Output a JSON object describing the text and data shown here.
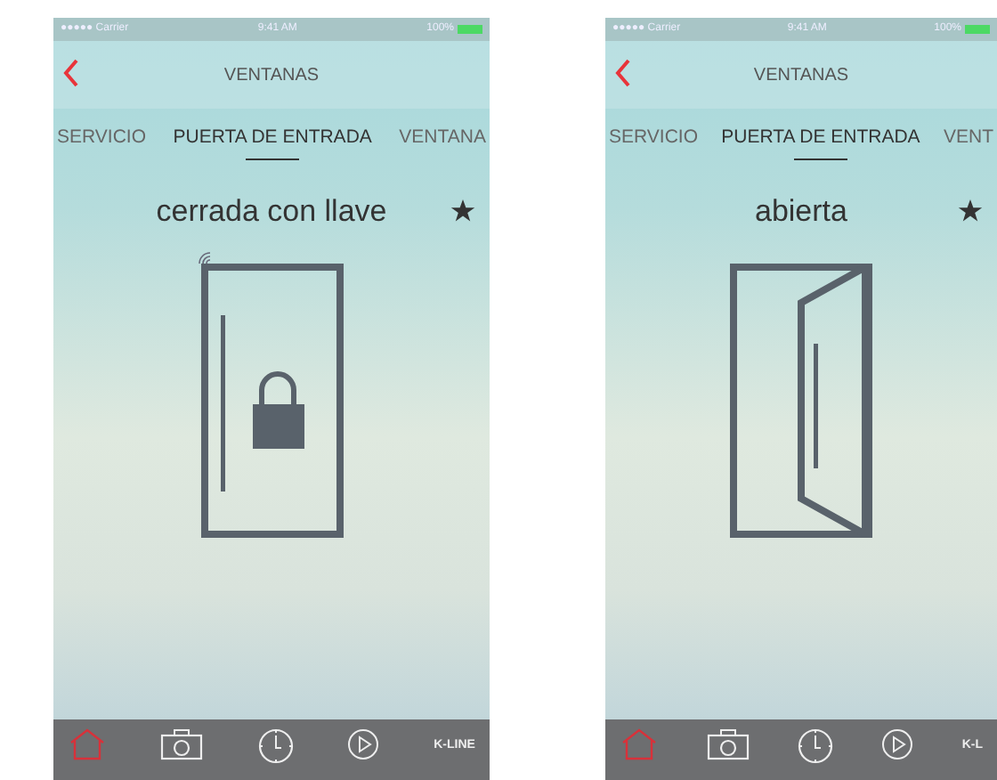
{
  "screens": [
    {
      "status_bar": {
        "carrier": "●●●●● Carrier",
        "time": "9:41 AM",
        "battery": "100%"
      },
      "title": "VENTANAS",
      "tabs": [
        {
          "label": "SERVICIO",
          "selected": false
        },
        {
          "label": "PUERTA DE ENTRADA",
          "selected": true
        },
        {
          "label": "VENTANA",
          "selected": false
        }
      ],
      "state_label": "cerrada con llave",
      "door": {
        "kind": "locked",
        "signal": true
      },
      "favorite": true,
      "tab_bar": [
        {
          "kind": "home",
          "selected": true
        },
        {
          "kind": "camera",
          "selected": false
        },
        {
          "kind": "clock",
          "selected": false
        },
        {
          "kind": "play",
          "selected": false
        },
        {
          "kind": "logo",
          "text": "K-LINE",
          "selected": false
        }
      ]
    },
    {
      "status_bar": {
        "carrier": "●●●●● Carrier",
        "time": "9:41 AM",
        "battery": "100%"
      },
      "title": "VENTANAS",
      "tabs": [
        {
          "label": "SERVICIO",
          "selected": false
        },
        {
          "label": "PUERTA DE ENTRADA",
          "selected": true
        },
        {
          "label": "VENT",
          "selected": false
        }
      ],
      "state_label": "abierta",
      "door": {
        "kind": "open",
        "signal": false
      },
      "favorite": true,
      "tab_bar": [
        {
          "kind": "home",
          "selected": true
        },
        {
          "kind": "camera",
          "selected": false
        },
        {
          "kind": "clock",
          "selected": false
        },
        {
          "kind": "play",
          "selected": false
        },
        {
          "kind": "logo",
          "text": "K-L",
          "selected": false
        }
      ]
    }
  ]
}
